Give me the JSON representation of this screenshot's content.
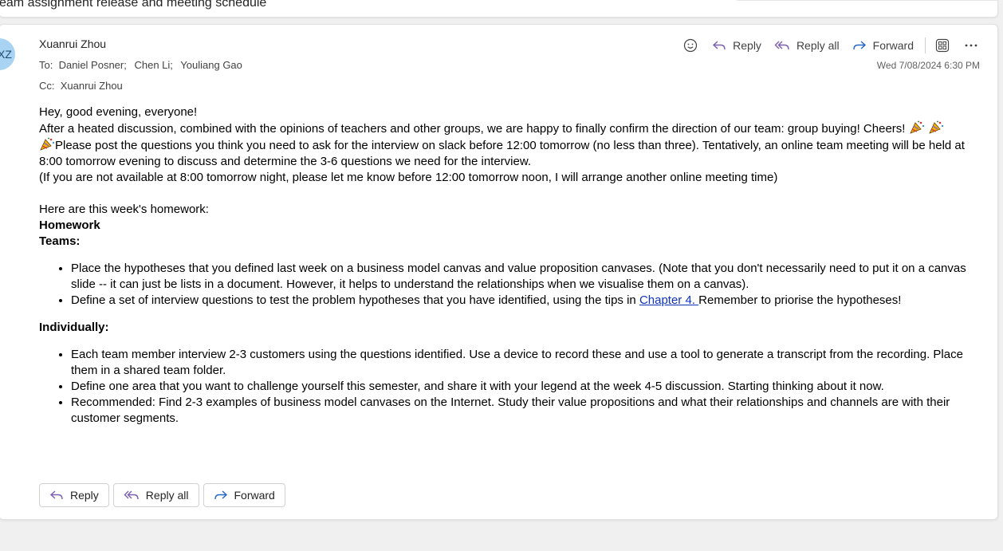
{
  "subject": "eam assignment release and meeting schedule",
  "message": {
    "avatar_initials": "XZ",
    "sender": "Xuanrui Zhou",
    "to_label": "To:",
    "to": [
      "Daniel Posner;",
      "Chen Li;",
      "Youliang Gao"
    ],
    "cc_label": "Cc:",
    "cc": [
      "Xuanrui Zhou"
    ],
    "date": "Wed 7/08/2024 6:30 PM"
  },
  "toolbar": {
    "emoji_icon": "smiley-icon",
    "reply_label": "Reply",
    "reply_all_label": "Reply all",
    "forward_label": "Forward",
    "apps_icon": "apps-grid-icon",
    "more_icon": "more-ellipsis-icon"
  },
  "body": {
    "greeting": "Hey, good evening, everyone!",
    "para1": "After a heated discussion, combined with the opinions of teachers and other groups, we are happy to finally confirm the direction of our team: group buying! Cheers!",
    "para2": "Please post the questions you think you need to ask for the interview on slack before 12:00 tomorrow (no less than three). Tentatively, an online team meeting will be held at 8:00 tomorrow evening to discuss and determine the 3-6 questions we need for the interview.",
    "para3": " (If you are not available at 8:00 tomorrow night, please let me know before 12:00 tomorrow noon, I will arrange another online meeting time)",
    "homework_intro": "Here are this week's homework:",
    "homework_heading": "Homework",
    "teams_heading": "Teams:",
    "teams_items": [
      "Place the hypotheses that you defined last week on a business model canvas and value proposition canvases. (Note that you don't necessarily need to put it on a canvas slide -- it can just be lists in a document. However, it helps to understand the relationships when we visualise them on a canvas)."
    ],
    "teams_item2_before": "Define a set of interview questions to test the problem hypotheses that you have identified, using the tips in ",
    "teams_item2_link": "Chapter 4. ",
    "teams_item2_after": " Remember to priorise the hypotheses!",
    "individually_heading": "Individually:",
    "individual_items": [
      "Each team member interview 2-3 customers using the questions identified. Use a device to record these and use a tool to generate a transcript from the recording. Place them in a shared team folder.",
      "Define one area that you want to challenge yourself this semester, and share it with your legend at the week 4-5 discussion. Starting thinking about it now.",
      "Recommended: Find 2-3 examples of business model canvases on the Internet. Study their value propositions and what their relationships and channels are with their customer segments."
    ]
  },
  "bottom": {
    "reply_label": "Reply",
    "reply_all_label": "Reply all",
    "forward_label": "Forward"
  },
  "colors": {
    "avatar_bg": "#a9d3f2",
    "link": "#0f33b8",
    "reply_icon": "#7a5fb0",
    "forward_icon": "#2266c8"
  }
}
